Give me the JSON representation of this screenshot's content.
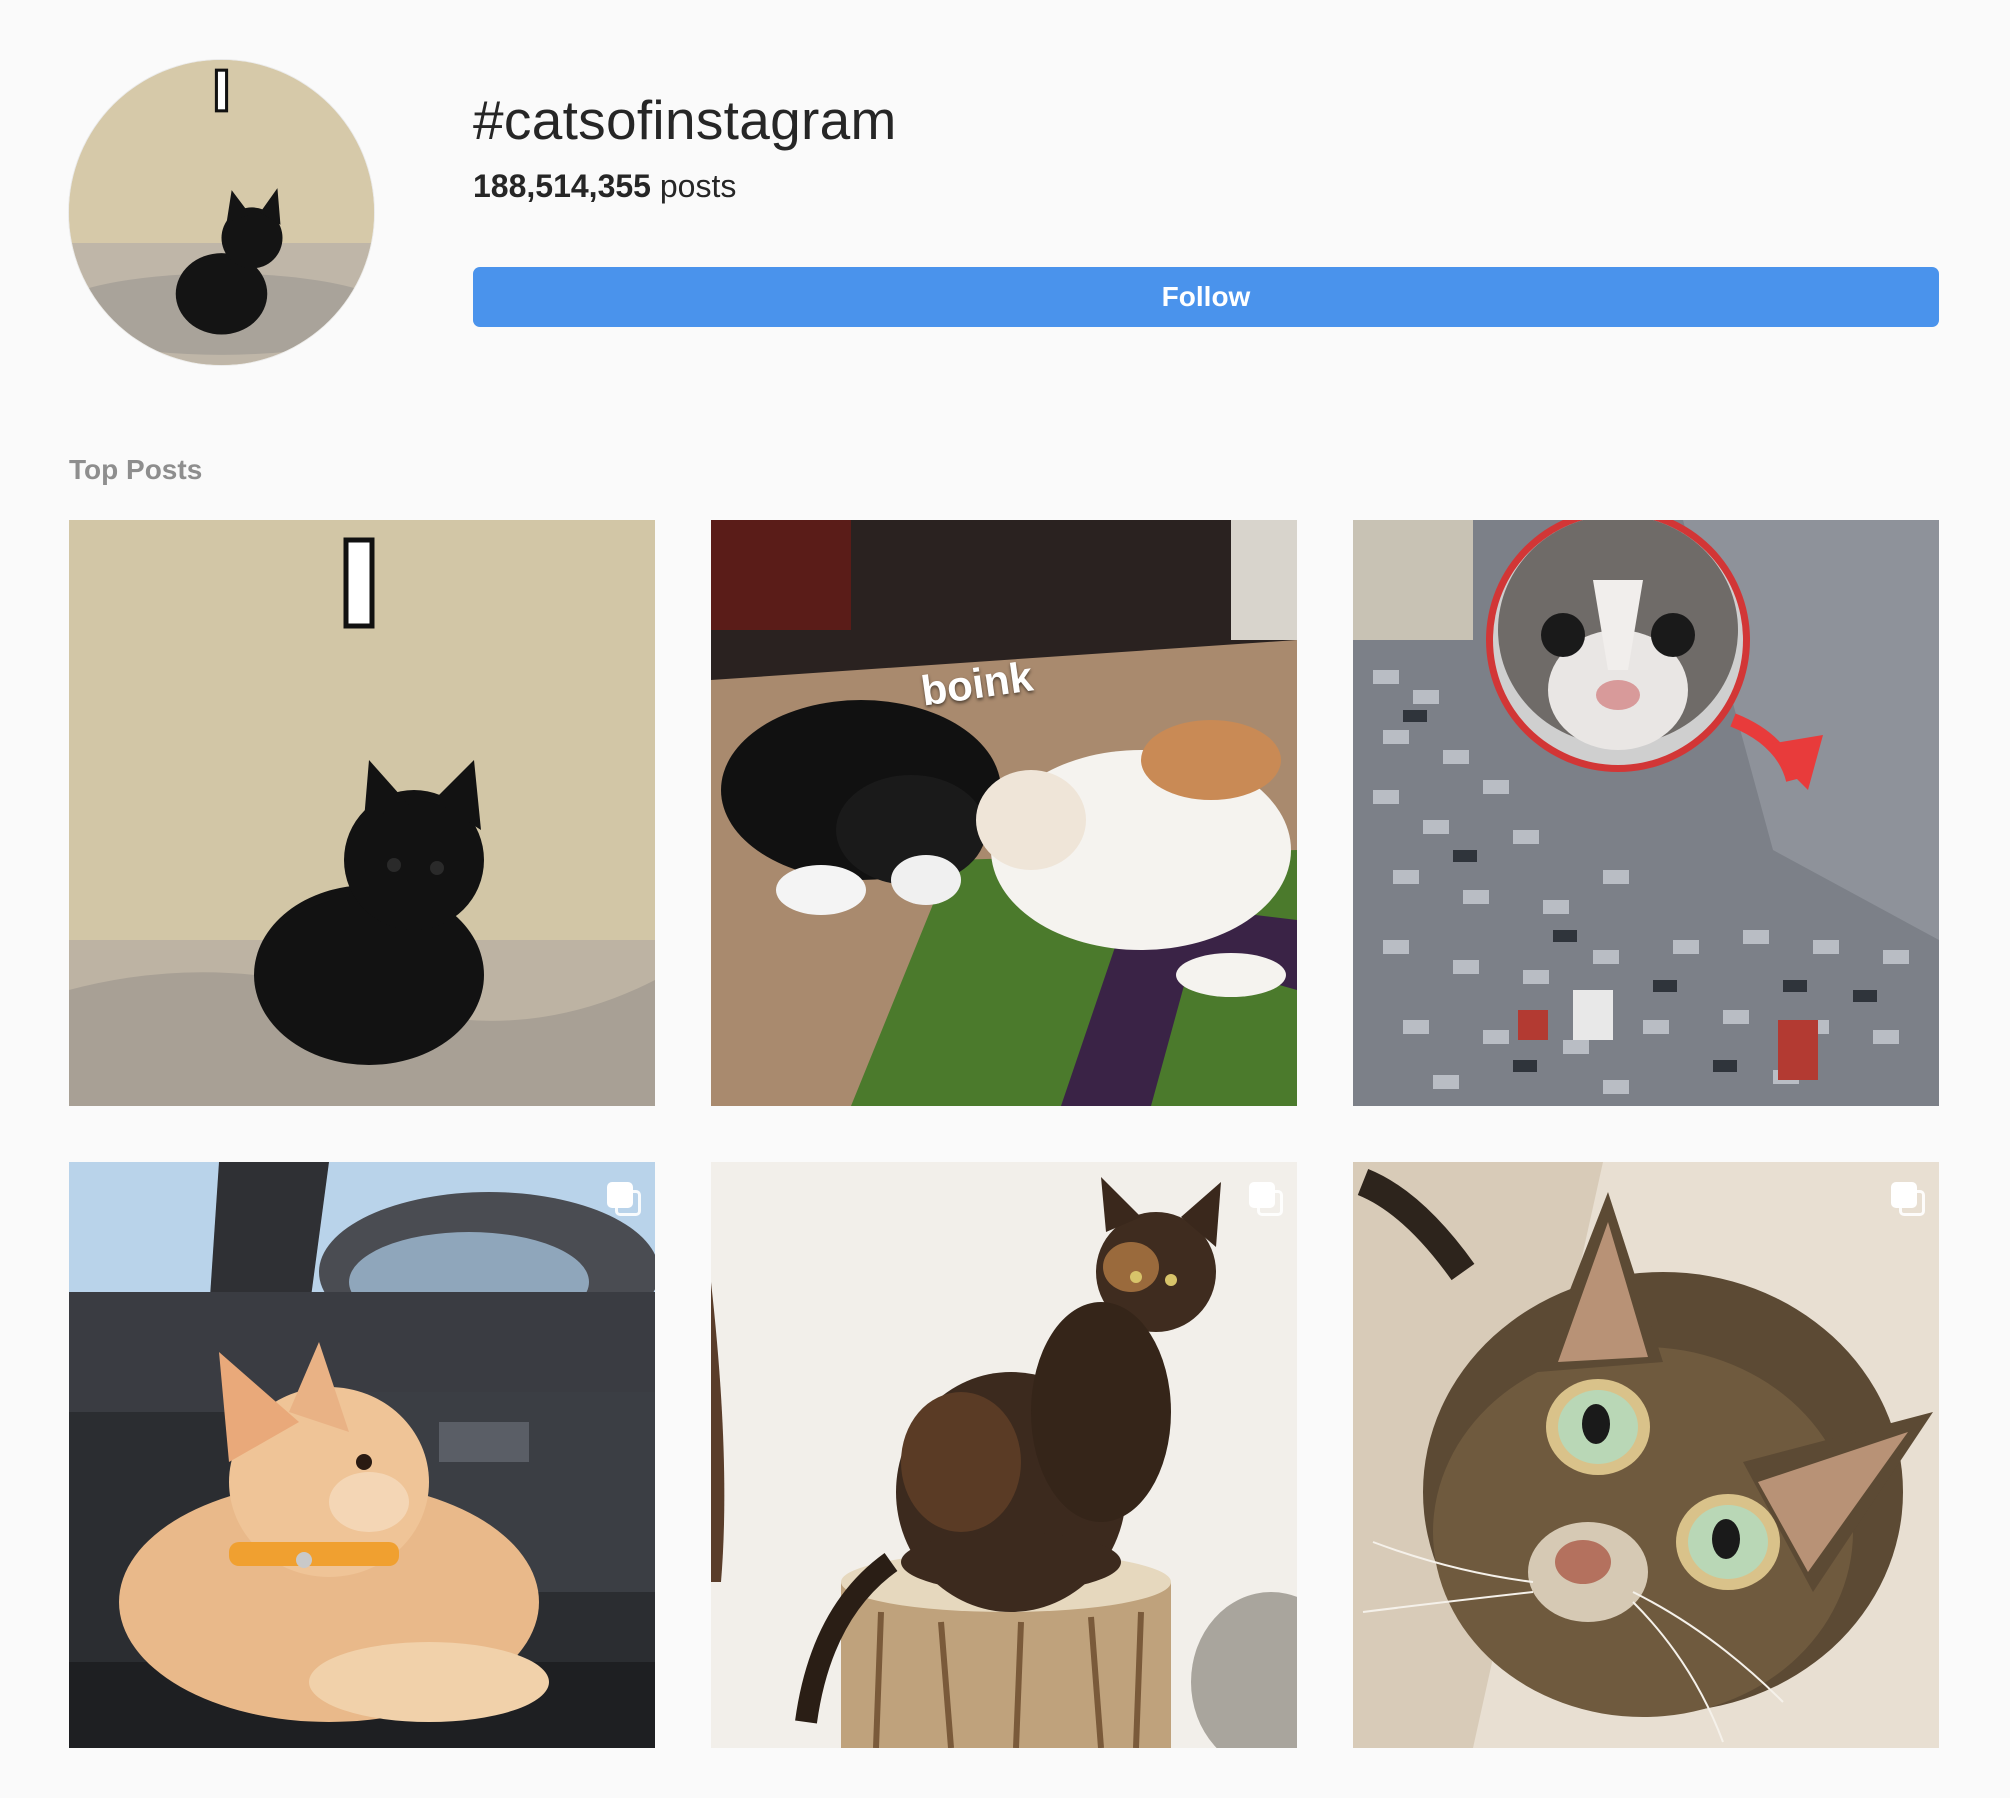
{
  "header": {
    "hashtag": "#catsofinstagram",
    "post_count": "188,514,355",
    "post_count_suffix": "posts",
    "follow_label": "Follow"
  },
  "colors": {
    "follow_button": "#4a93ec",
    "background": "#fafafa",
    "section_title": "#8e8e8e"
  },
  "section": {
    "title": "Top Posts"
  },
  "posts": [
    {
      "content": "black kitten on a bed",
      "carousel": false
    },
    {
      "content": "black-and-white kitten and calico kitten bumping heads on a striped rug",
      "caption": "boink",
      "carousel": false
    },
    {
      "content": "cat face in a red circle with an arrow over a traffic jam",
      "carousel": false
    },
    {
      "content": "orange kitten in a car seat",
      "carousel": true,
      "icon": "carousel-icon"
    },
    {
      "content": "tortoiseshell cat sitting on a wooden stump",
      "carousel": true,
      "icon": "carousel-icon"
    },
    {
      "content": "tabby cat with green eyes looking up",
      "carousel": true,
      "icon": "carousel-icon"
    }
  ]
}
